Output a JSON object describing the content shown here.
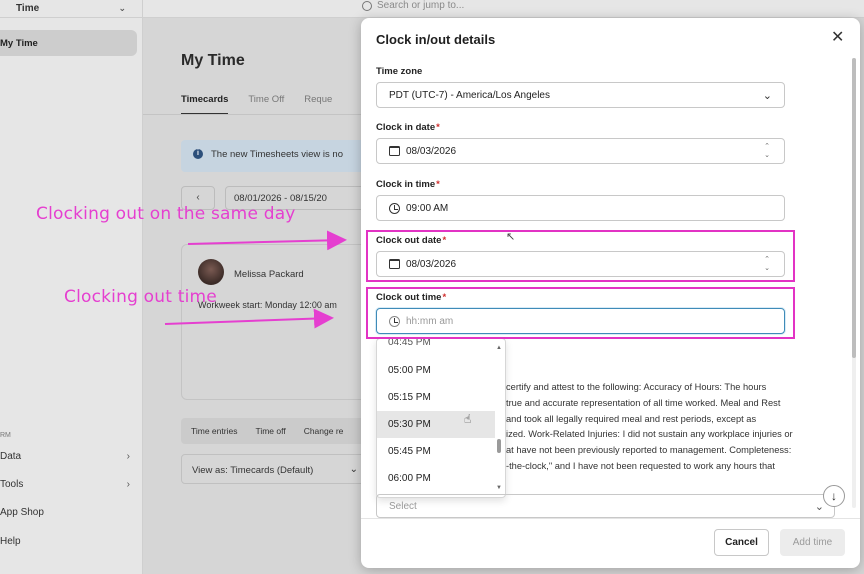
{
  "sidebar": {
    "app_selector": "Time",
    "active_item": "My Time",
    "section_label": "RM",
    "items": [
      {
        "label": "Data"
      },
      {
        "label": "Tools"
      },
      {
        "label": "App Shop"
      },
      {
        "label": "Help"
      }
    ]
  },
  "topbar": {
    "search_placeholder": "Search or jump to..."
  },
  "page": {
    "title": "My Time",
    "tabs": [
      "Timecards",
      "Time Off",
      "Reque"
    ],
    "banner": "The new Timesheets view is no",
    "date_range": "08/01/2026 - 08/15/20",
    "employee_name": "Melissa Packard",
    "workweek": "Workweek start: Monday 12:00 am",
    "subtabs": [
      "Time entries",
      "Time off",
      "Change re"
    ],
    "view_as": "View as: Timecards (Default)"
  },
  "modal": {
    "title": "Clock in/out details",
    "time_zone_label": "Time zone",
    "time_zone_value": "PDT (UTC-7) - America/Los Angeles",
    "clock_in_date_label": "Clock in date",
    "clock_in_date_value": "08/03/2026",
    "clock_in_time_label": "Clock in time",
    "clock_in_time_value": "09:00 AM",
    "clock_out_date_label": "Clock out date",
    "clock_out_date_value": "08/03/2026",
    "clock_out_time_label": "Clock out time",
    "clock_out_time_placeholder": "hh:mm am",
    "required_mark": "*",
    "time_options": [
      "04:45 PM",
      "05:00 PM",
      "05:15 PM",
      "05:30 PM",
      "05:45 PM",
      "06:00 PM"
    ],
    "highlighted_option": "05:30 PM",
    "attestation_lines": [
      "certify and attest to the following: Accuracy of Hours: The hours",
      "true and accurate representation of all time worked. Meal and Rest",
      "and took all legally required meal and rest periods, except as",
      "ized. Work-Related Injuries: I did not sustain any workplace injuries or",
      "at have not been previously reported to management. Completeness:",
      "-the-clock,\" and I have not been requested to work any hours that"
    ],
    "select_placeholder": "Select",
    "cancel_label": "Cancel",
    "add_label": "Add time"
  },
  "annotations": {
    "same_day": "Clocking out on the same day",
    "out_time": "Clocking out time",
    "color": "#e53fd0"
  }
}
